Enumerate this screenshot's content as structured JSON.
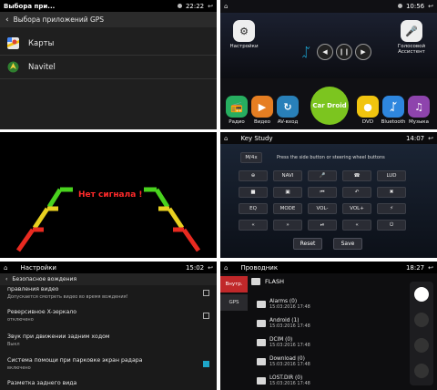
{
  "panel1": {
    "title": "Выбора при...",
    "time": "22:22",
    "header": "Выбора приложений GPS",
    "items": [
      {
        "label": "Карты"
      },
      {
        "label": "Navitel"
      }
    ]
  },
  "panel2": {
    "time": "10:56",
    "top_apps": [
      {
        "label": "Настройки"
      },
      {
        "label": "Голосовой Ассистент"
      }
    ],
    "bottom_apps": [
      {
        "label": "Радио",
        "color": "#27ae60"
      },
      {
        "label": "Видео",
        "color": "#e67e22"
      },
      {
        "label": "AV-вход",
        "color": "#2980b9"
      },
      {
        "label": "DVD",
        "color": "#f1c40f"
      },
      {
        "label": "Bluetooth",
        "color": "#2e86de"
      },
      {
        "label": "Музыка",
        "color": "#8e44ad"
      }
    ],
    "center_logo": "Car Droid"
  },
  "panel3": {
    "no_signal": "Нет сигнала !"
  },
  "panel4": {
    "title": "Key Study",
    "time": "14:07",
    "mode": "M/4x",
    "hint": "Press the side button or steering wheel buttons",
    "rows": [
      [
        "⊕",
        "NAVI",
        "🎤",
        "☎",
        "LUD"
      ],
      [
        "■",
        "▣",
        "⏮",
        "↶",
        "✖"
      ],
      [
        "EQ",
        "MODE",
        "VOL-",
        "VOL+",
        "⚡"
      ],
      [
        "«",
        "»",
        "⏯",
        "«",
        "⏻"
      ]
    ],
    "reset": "Reset",
    "save": "Save"
  },
  "panel5": {
    "title": "Настройки",
    "time": "15:02",
    "header": "Безопасное вождения",
    "rows": [
      {
        "title": "правления видео",
        "sub": "Допускается смотреть видео во время вождения!",
        "checked": false
      },
      {
        "title": "Реверсивное X-зеркало",
        "sub": "отключено",
        "checked": false
      },
      {
        "title": "Звук при движении задним ходом",
        "sub": "Выкл",
        "checked": false
      },
      {
        "title": "Система помощи при парковке экран радара",
        "sub": "включено",
        "checked": true
      },
      {
        "title": "Разметка заднего вида",
        "sub": "",
        "checked": false
      }
    ]
  },
  "panel6": {
    "title": "Проводник",
    "time": "18:27",
    "tabs": [
      {
        "label": "Внутр."
      },
      {
        "label": "GPS"
      }
    ],
    "root": "FLASH",
    "files": [
      {
        "name": "Alarms (0)",
        "date": "15:03:2016 17:48"
      },
      {
        "name": "Android (1)",
        "date": "15:03:2016 17:48"
      },
      {
        "name": "DCIM (0)",
        "date": "15:03:2016 17:48"
      },
      {
        "name": "Download (0)",
        "date": "15:03:2016 17:48"
      },
      {
        "name": "LOST.DIR (0)",
        "date": "15:03:2016 17:48"
      }
    ]
  }
}
